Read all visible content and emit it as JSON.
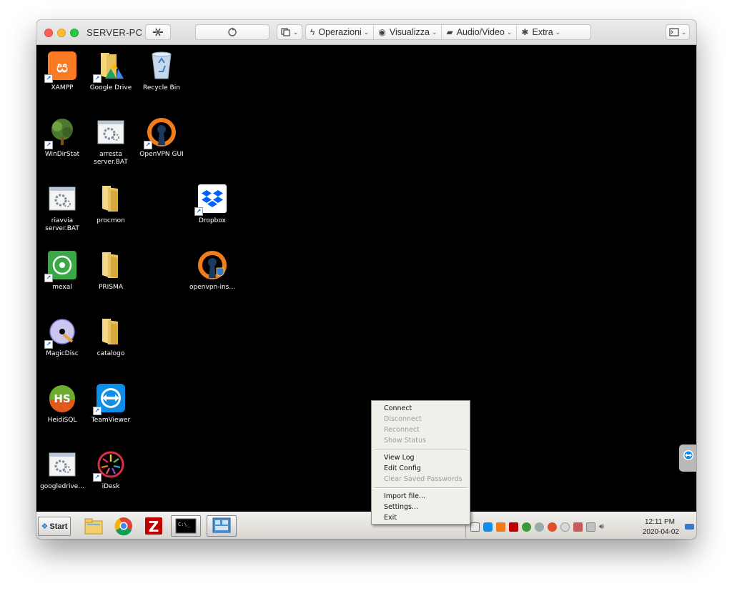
{
  "window": {
    "host_name": "SERVER-PC",
    "toolbar": {
      "menus": [
        {
          "label": "Operazioni",
          "icon": "lightning-icon"
        },
        {
          "label": "Visualizza",
          "icon": "eye-icon"
        },
        {
          "label": "Audio/Video",
          "icon": "chat-icon"
        },
        {
          "label": "Extra",
          "icon": "tools-icon"
        }
      ]
    }
  },
  "desktop": {
    "icons": [
      {
        "label": "XAMPP"
      },
      {
        "label": "Google Drive"
      },
      {
        "label": "Recycle Bin"
      },
      {
        "label": "WinDirStat"
      },
      {
        "label": "arresta server.BAT"
      },
      {
        "label": "OpenVPN GUI"
      },
      {
        "label": "riavvia server.BAT"
      },
      {
        "label": "procmon"
      },
      {
        "label": "Dropbox"
      },
      {
        "label": "mexal"
      },
      {
        "label": "PRISMA"
      },
      {
        "label": "openvpn-ins..."
      },
      {
        "label": "MagicDisc"
      },
      {
        "label": "catalogo"
      },
      {
        "label": "HeidiSQL"
      },
      {
        "label": "TeamViewer"
      },
      {
        "label": "googledrive..."
      },
      {
        "label": "iDesk"
      }
    ]
  },
  "context_menu": {
    "items": [
      {
        "label": "Connect",
        "enabled": true
      },
      {
        "label": "Disconnect",
        "enabled": false
      },
      {
        "label": "Reconnect",
        "enabled": false
      },
      {
        "label": "Show Status",
        "enabled": false
      },
      {
        "label": "View Log",
        "enabled": true
      },
      {
        "label": "Edit Config",
        "enabled": true
      },
      {
        "label": "Clear Saved Passwords",
        "enabled": false
      },
      {
        "label": "Import file...",
        "enabled": true
      },
      {
        "label": "Settings...",
        "enabled": true
      },
      {
        "label": "Exit",
        "enabled": true
      }
    ]
  },
  "taskbar": {
    "start_label": "Start",
    "clock_time": "12:11 PM",
    "clock_date": "2020-04-02"
  }
}
